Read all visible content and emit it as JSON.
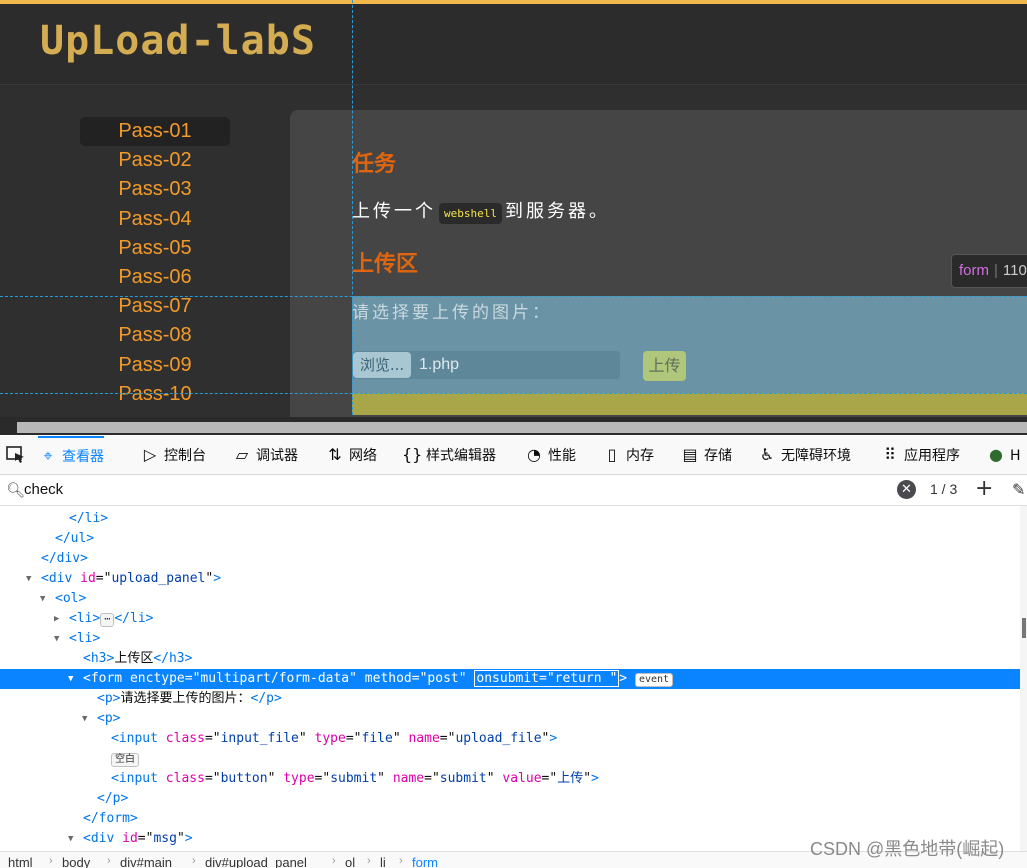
{
  "page": {
    "logo_text": "UpLoad-labS",
    "nav_items": [
      "Pass-01",
      "Pass-02",
      "Pass-03",
      "Pass-04",
      "Pass-05",
      "Pass-06",
      "Pass-07",
      "Pass-08",
      "Pass-09",
      "Pass-10"
    ],
    "active_nav": "Pass-01",
    "task_heading": "任务",
    "task_before": "上传一个",
    "task_code": "webshell",
    "task_after": "到服务器。",
    "upload_heading": "上传区",
    "choose_label": "请选择要上传的图片：",
    "browse_label": "浏览...",
    "file_name": "1.php",
    "submit_label": "上传",
    "tooltip_tag": "form",
    "tooltip_size": "110",
    "accent_color": "#f2b84b",
    "nav_color": "#f29a2a",
    "heading_color": "#e0650f"
  },
  "devtools": {
    "tabs": [
      {
        "icon": "inspector-icon",
        "glyph": "⌖",
        "label": "查看器",
        "active": true
      },
      {
        "icon": "console-icon",
        "glyph": "▷",
        "label": "控制台"
      },
      {
        "icon": "debugger-icon",
        "glyph": "▱",
        "label": "调试器"
      },
      {
        "icon": "network-icon",
        "glyph": "⇅",
        "label": "网络"
      },
      {
        "icon": "style-editor-icon",
        "glyph": "{}",
        "label": "样式编辑器"
      },
      {
        "icon": "performance-icon",
        "glyph": "◔",
        "label": "性能"
      },
      {
        "icon": "memory-icon",
        "glyph": "▯",
        "label": "内存"
      },
      {
        "icon": "storage-icon",
        "glyph": "▤",
        "label": "存储"
      },
      {
        "icon": "accessibility-icon",
        "glyph": "♿",
        "label": "无障碍环境"
      },
      {
        "icon": "application-icon",
        "glyph": "⠿",
        "label": "应用程序"
      },
      {
        "icon": "extension-icon",
        "glyph": "●",
        "label": "H"
      }
    ],
    "search": {
      "value": "check",
      "match_count": "1 / 3"
    },
    "tree_rows": [
      {
        "indent": 5,
        "twisty": "",
        "parts": [
          [
            "t",
            "</li>"
          ]
        ]
      },
      {
        "indent": 4,
        "twisty": "",
        "parts": [
          [
            "t",
            "</ul>"
          ]
        ]
      },
      {
        "indent": 3,
        "twisty": "",
        "parts": [
          [
            "t",
            "</div>"
          ]
        ]
      },
      {
        "indent": 3,
        "twisty": "▼",
        "parts": [
          [
            "t",
            "<div "
          ],
          [
            "n",
            "id"
          ],
          [
            "p",
            "=\""
          ],
          [
            "v",
            "upload_panel"
          ],
          [
            "p",
            "\""
          ],
          [
            "t",
            ">"
          ]
        ]
      },
      {
        "indent": 4,
        "twisty": "▼",
        "parts": [
          [
            "t",
            "<ol>"
          ]
        ]
      },
      {
        "indent": 5,
        "twisty": "▶",
        "parts": [
          [
            "t",
            "<li>"
          ],
          [
            "b",
            "⋯"
          ],
          [
            "t",
            "</li>"
          ]
        ]
      },
      {
        "indent": 5,
        "twisty": "▼",
        "parts": [
          [
            "t",
            "<li>"
          ]
        ]
      },
      {
        "indent": 6,
        "twisty": "",
        "parts": [
          [
            "t",
            "<h3>"
          ],
          [
            "p",
            "上传区"
          ],
          [
            "t",
            "</h3>"
          ]
        ]
      },
      {
        "indent": 6,
        "twisty": "▼",
        "selected": true,
        "parts": [
          [
            "t",
            "<form "
          ],
          [
            "n",
            "enctype"
          ],
          [
            "p",
            "=\""
          ],
          [
            "v",
            "multipart/form-data"
          ],
          [
            "p",
            "\" "
          ],
          [
            "n",
            "method"
          ],
          [
            "p",
            "=\""
          ],
          [
            "v",
            "post"
          ],
          [
            "p",
            "\" "
          ],
          [
            "h",
            "onsubmit=\"return \""
          ],
          [
            "t",
            ">"
          ],
          [
            "p",
            " "
          ],
          [
            "b",
            "event"
          ]
        ]
      },
      {
        "indent": 7,
        "twisty": "",
        "parts": [
          [
            "t",
            "<p>"
          ],
          [
            "p",
            "请选择要上传的图片："
          ],
          [
            "t",
            "</p>"
          ]
        ]
      },
      {
        "indent": 7,
        "twisty": "▼",
        "parts": [
          [
            "t",
            "<p>"
          ]
        ]
      },
      {
        "indent": 8,
        "twisty": "",
        "parts": [
          [
            "t",
            "<input "
          ],
          [
            "n",
            "class"
          ],
          [
            "p",
            "=\""
          ],
          [
            "v",
            "input_file"
          ],
          [
            "p",
            "\" "
          ],
          [
            "n",
            "type"
          ],
          [
            "p",
            "=\""
          ],
          [
            "v",
            "file"
          ],
          [
            "p",
            "\" "
          ],
          [
            "n",
            "name"
          ],
          [
            "p",
            "=\""
          ],
          [
            "v",
            "upload_file"
          ],
          [
            "p",
            "\""
          ],
          [
            "t",
            ">"
          ]
        ]
      },
      {
        "indent": 8,
        "twisty": "",
        "parts": [
          [
            "b",
            "空白"
          ]
        ]
      },
      {
        "indent": 8,
        "twisty": "",
        "parts": [
          [
            "t",
            "<input "
          ],
          [
            "n",
            "class"
          ],
          [
            "p",
            "=\""
          ],
          [
            "v",
            "button"
          ],
          [
            "p",
            "\" "
          ],
          [
            "n",
            "type"
          ],
          [
            "p",
            "=\""
          ],
          [
            "v",
            "submit"
          ],
          [
            "p",
            "\" "
          ],
          [
            "n",
            "name"
          ],
          [
            "p",
            "=\""
          ],
          [
            "v",
            "submit"
          ],
          [
            "p",
            "\" "
          ],
          [
            "n",
            "value"
          ],
          [
            "p",
            "=\""
          ],
          [
            "v",
            "上传"
          ],
          [
            "p",
            "\""
          ],
          [
            "t",
            ">"
          ]
        ]
      },
      {
        "indent": 7,
        "twisty": "",
        "parts": [
          [
            "t",
            "</p>"
          ]
        ]
      },
      {
        "indent": 6,
        "twisty": "",
        "parts": [
          [
            "t",
            "</form>"
          ]
        ]
      },
      {
        "indent": 6,
        "twisty": "▼",
        "parts": [
          [
            "t",
            "<div "
          ],
          [
            "n",
            "id"
          ],
          [
            "p",
            "=\""
          ],
          [
            "v",
            "msg"
          ],
          [
            "p",
            "\""
          ],
          [
            "t",
            ">"
          ]
        ]
      }
    ],
    "breadcrumb": [
      "html",
      "body",
      "div#main",
      "div#upload_panel",
      "ol",
      "li",
      "form"
    ]
  },
  "watermark": "CSDN @黑色地带(崛起)"
}
